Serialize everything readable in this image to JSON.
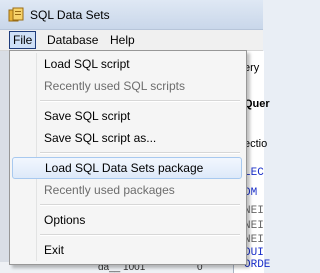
{
  "window": {
    "title": "SQL Data Sets"
  },
  "menubar": {
    "items": [
      "File",
      "Database",
      "Help"
    ]
  },
  "file_menu": {
    "items": [
      {
        "label": "Load SQL script",
        "enabled": true
      },
      {
        "label": "Recently used SQL scripts",
        "enabled": false
      },
      {
        "label": "Save SQL script",
        "enabled": true
      },
      {
        "label": "Save SQL script as...",
        "enabled": true
      },
      {
        "label": "Load SQL Data Sets package",
        "enabled": true,
        "highlighted": true
      },
      {
        "label": "Recently used packages",
        "enabled": false
      },
      {
        "label": "Options",
        "enabled": true
      },
      {
        "label": "Exit",
        "enabled": true
      }
    ]
  },
  "background": {
    "right_fragments": [
      "ery",
      "Quer",
      "ectio",
      "LEC",
      "OM",
      "NEI",
      "NEI",
      "NEI",
      "OUI",
      "ORDE"
    ],
    "bottom_fragments": [
      "0",
      "da__ 1001"
    ]
  },
  "colors": {
    "menu_highlight": "#cfe0f7",
    "keyword_blue": "#1a2fc9"
  }
}
